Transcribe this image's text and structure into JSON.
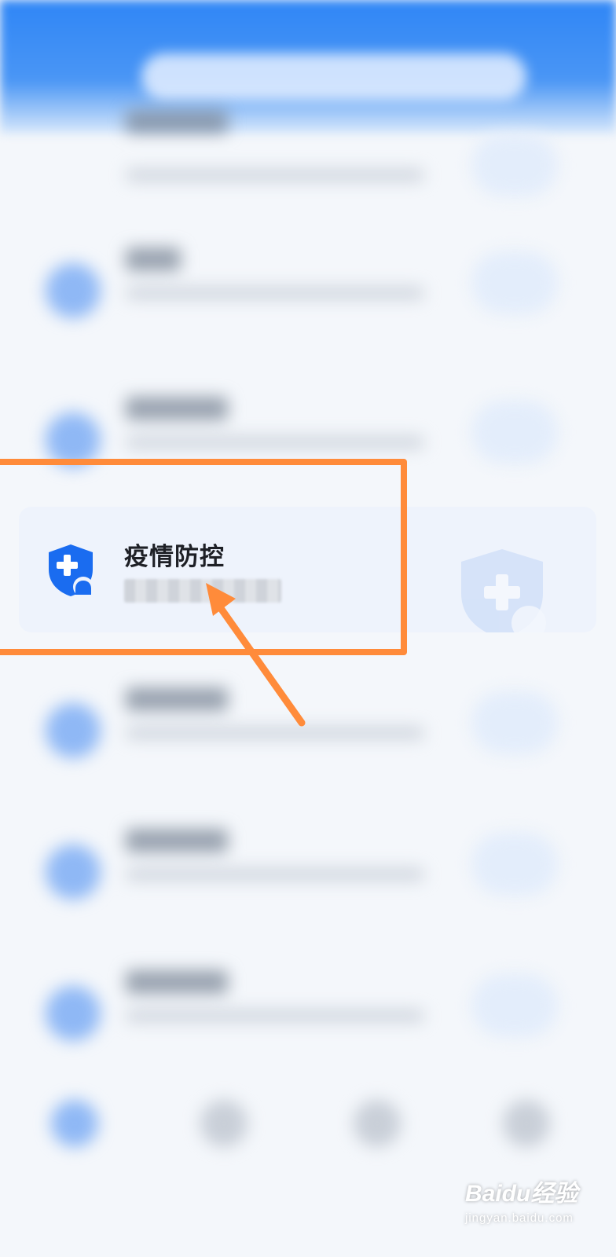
{
  "card": {
    "title": "疫情防控",
    "icon": "shield-plus-icon"
  },
  "highlight_color": "#ff8b3a",
  "accent_color": "#2f86f6",
  "watermark": {
    "brand": "Baidu经验",
    "url": "jingyan.baidu.com"
  }
}
